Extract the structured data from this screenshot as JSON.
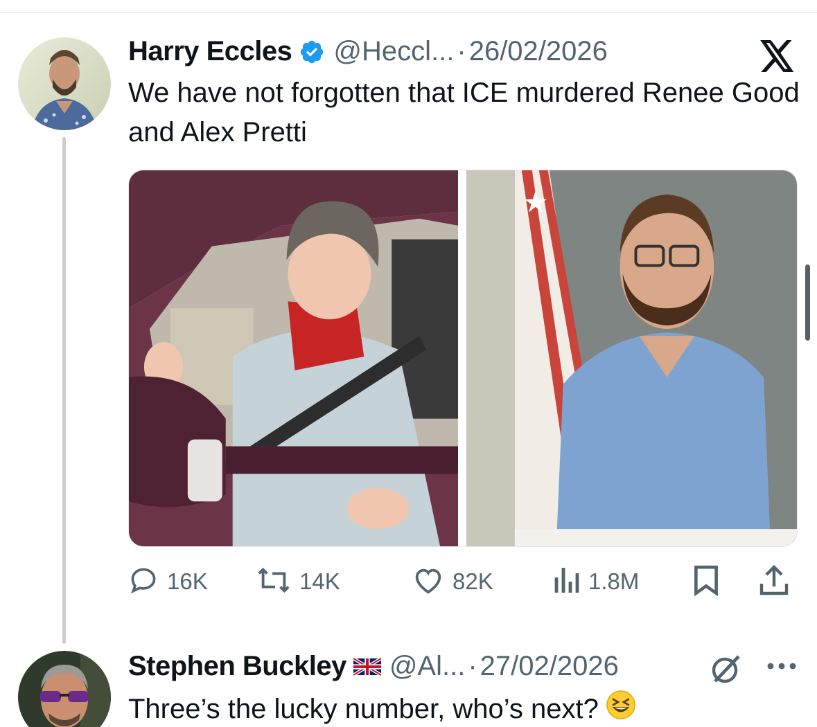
{
  "main_tweet": {
    "author_name": "Harry Eccles",
    "handle": "@Heccl...",
    "separator": "·",
    "date": "26/02/2026",
    "text": "We have not forgotten that ICE murdered Renee Good and Alex Pretti",
    "verified": true,
    "stats": {
      "replies": "16K",
      "reposts": "14K",
      "likes": "82K",
      "views": "1.8M"
    }
  },
  "reply_tweet": {
    "author_name": "Stephen Buckley",
    "handle": "@Al...",
    "separator": "·",
    "date": "27/02/2026",
    "text": "Three’s the lucky number, who’s next?",
    "flag": "uk-flag-icon",
    "emoji": "grinning-squinting-face-emoji"
  },
  "colors": {
    "verified_blue": "#1d9bf0",
    "muted_text": "#536471",
    "primary_text": "#0f1419"
  }
}
